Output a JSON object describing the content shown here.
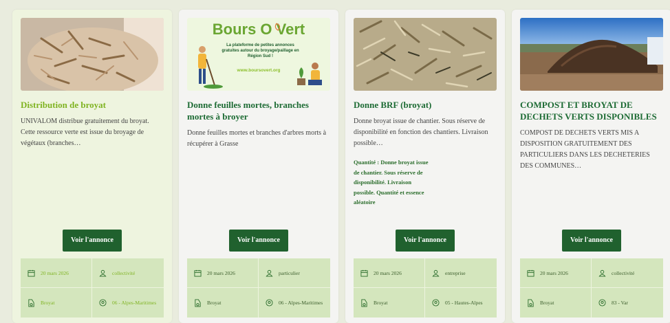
{
  "cards": [
    {
      "title": "Distribution de broyat",
      "description": "UNIVALOM distribue gratuitement du broyat. Cette ressource verte est issue du broyage de végétaux (branches…",
      "button": "Voir l'annonce",
      "meta": {
        "date": "20 mars 2026",
        "type": "collectivité",
        "category": "Broyat",
        "location": "06 - Alpes-Maritimes"
      }
    },
    {
      "title": "Donne feuilles mortes, branches mortes à broyer",
      "description": "Donne feuilles mortes et branches d'arbres morts à récupérer à Grasse",
      "button": "Voir l'annonce",
      "image": {
        "brand": "Bours O Vert",
        "tagline": "La plateforme de petites annonces gratuites autour du broyage/paillage en Région Sud !",
        "url": "www.boursovert.org"
      },
      "meta": {
        "date": "20 mars 2026",
        "type": "particulier",
        "category": "Broyat",
        "location": "06 - Alpes-Maritimes"
      }
    },
    {
      "title": "Donne BRF (broyat)",
      "description": "Donne broyat issue de chantier. Sous réserve de disponibilité en fonction des chantiers. Livraison possible…",
      "extra": "Quantité : Donne broyat issue de chantier. Sous réserve de disponibilité. Livraison possible. Quantité et essence aléatoire",
      "button": "Voir l'annonce",
      "meta": {
        "date": "20 mars 2026",
        "type": "entreprise",
        "category": "Broyat",
        "location": "05 - Hautes-Alpes"
      }
    },
    {
      "title": "COMPOST ET BROYAT DE DECHETS VERTS DISPONIBLES",
      "description": "COMPOST DE DECHETS VERTS MIS A DISPOSITION GRATUITEMENT DES PARTICULIERS DANS LES DECHETERIES DES COMMUNES…",
      "button": "Voir l'annonce",
      "meta": {
        "date": "20 mars 2026",
        "type": "collectivité",
        "category": "Broyat",
        "location": "83 - Var"
      }
    }
  ],
  "icons": {
    "date": "calendar-icon",
    "type": "user-icon",
    "category": "shredder-icon",
    "location": "map-pin-icon"
  },
  "colors": {
    "primary_green": "#20612e",
    "accent_green": "#7fb321",
    "meta_bg": "#d4e6bd",
    "page_bg": "#e9ecde"
  }
}
